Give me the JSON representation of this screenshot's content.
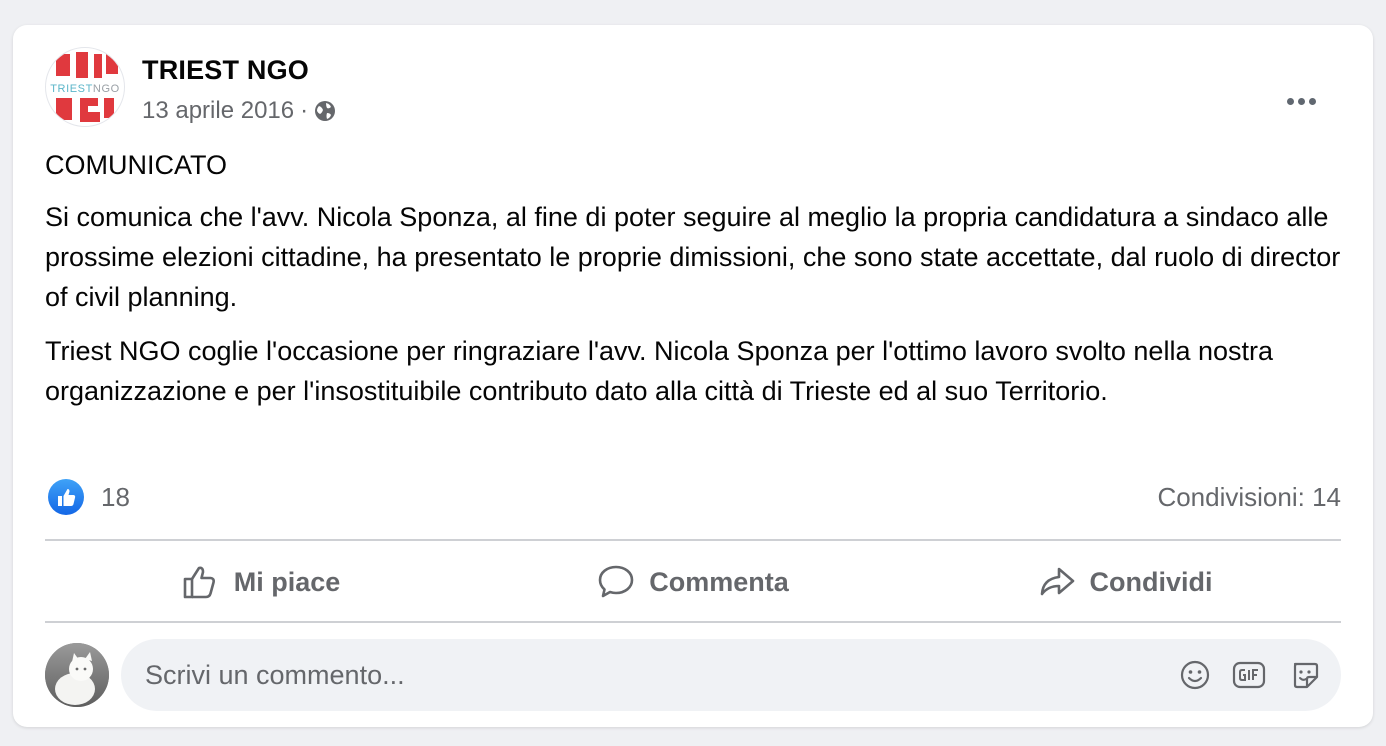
{
  "post": {
    "author": "TRIEST NGO",
    "logo_text": "TRIESTNGO",
    "date": "13 aprile 2016",
    "separator": "·",
    "privacy_icon": "globe-icon",
    "paragraphs": [
      "COMUNICATO",
      "Si comunica che l'avv. Nicola Sponza, al fine di poter seguire al meglio la propria candidatura a sindaco alle prossime elezioni cittadine, ha presentato le proprie dimissioni, che sono state accettate, dal ruolo di director of civil planning.",
      "Triest NGO coglie l'occasione per ringraziare l'avv. Nicola Sponza per l'ottimo lavoro svolto nella nostra organizzazione e per l'insostituibile contributo dato alla città di Trieste ed al suo Territorio."
    ]
  },
  "stats": {
    "likes": "18",
    "shares": "Condivisioni: 14"
  },
  "actions": {
    "like": "Mi piace",
    "comment": "Commenta",
    "share": "Condividi"
  },
  "comment_input": {
    "placeholder": "Scrivi un commento..."
  },
  "colors": {
    "like_blue": "#1877f2",
    "logo_red": "#e0393e",
    "logo_teal": "#5bb6c9",
    "muted_text": "#65676b"
  }
}
